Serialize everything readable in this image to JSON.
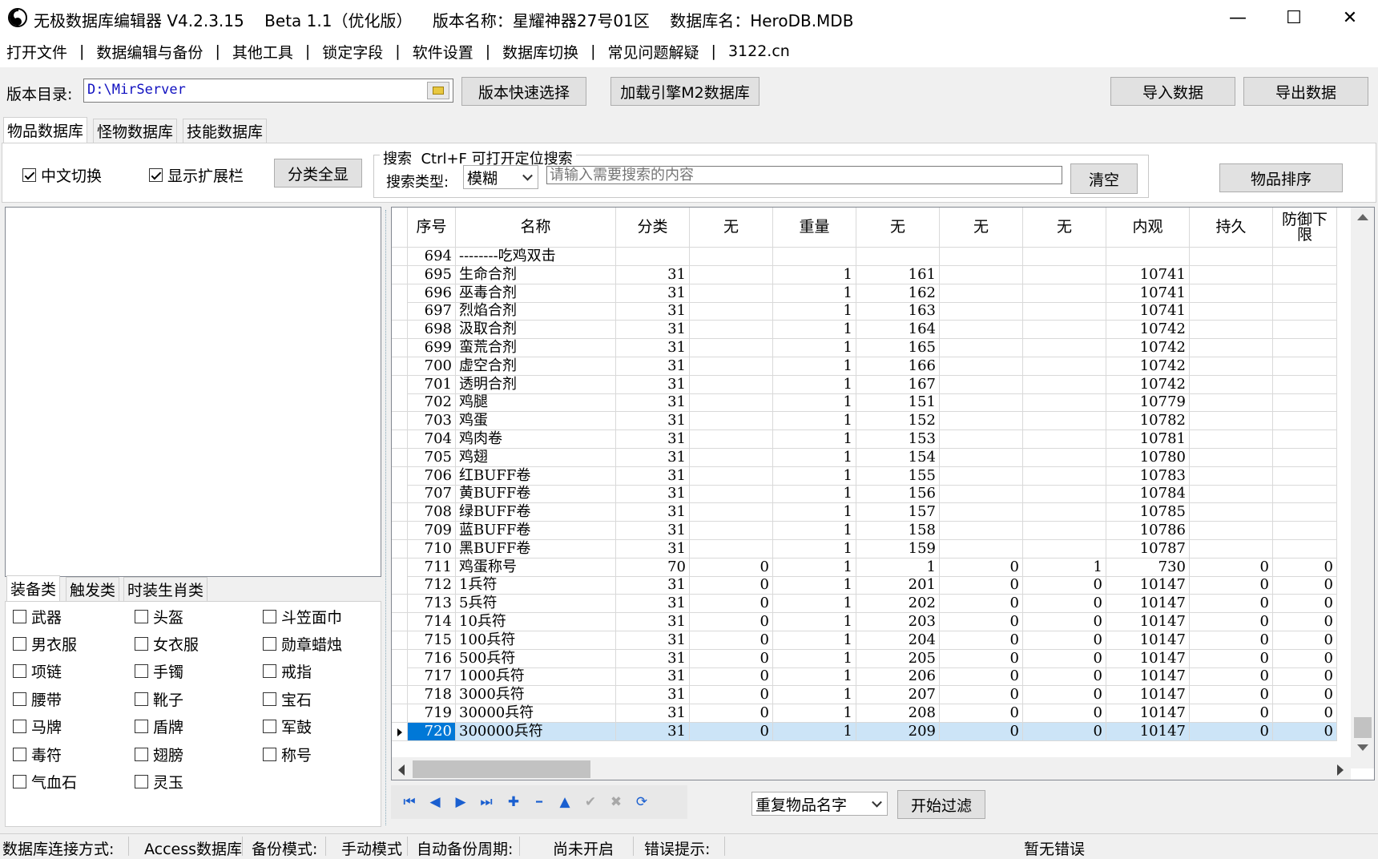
{
  "window": {
    "title": "无极数据库编辑器 V4.2.3.15    Beta 1.1（优化版）    版本名称：星耀神器27号01区    数据库名：HeroDB.MDB",
    "minimize": "—",
    "maximize": "☐",
    "close": "✕"
  },
  "menu": [
    "打开文件",
    "数据编辑与备份",
    "其他工具",
    "锁定字段",
    "软件设置",
    "数据库切换",
    "常见问题解疑",
    "3122.cn"
  ],
  "menu_sep": "|",
  "toolbar": {
    "dir_label": "版本目录:",
    "dir_value": "D:\\MirServer",
    "quick_select": "版本快速选择",
    "load_m2": "加载引擎M2数据库",
    "import": "导入数据",
    "export": "导出数据"
  },
  "tabs": [
    "物品数据库",
    "怪物数据库",
    "技能数据库"
  ],
  "filters": {
    "chinese_switch": "中文切换",
    "show_ext": "显示扩展栏",
    "show_all_cat": "分类全显",
    "search_legend": "搜索  Ctrl+F 可打开定位搜索",
    "search_type_label": "搜索类型:",
    "search_type_value": "模糊",
    "search_placeholder": "请输入需要搜索的内容",
    "clear": "清空",
    "sort": "物品排序"
  },
  "subtabs": [
    "装备类",
    "触发类",
    "时装生肖类"
  ],
  "categories": [
    [
      "武器",
      "头盔",
      "斗笠面巾"
    ],
    [
      "男衣服",
      "女衣服",
      "勋章蜡烛"
    ],
    [
      "项链",
      "手镯",
      "戒指"
    ],
    [
      "腰带",
      "靴子",
      "宝石"
    ],
    [
      "马牌",
      "盾牌",
      "军鼓"
    ],
    [
      "毒符",
      "翅膀",
      "称号"
    ],
    [
      "气血石",
      "灵玉"
    ]
  ],
  "grid": {
    "columns": [
      "序号",
      "名称",
      "分类",
      "无",
      "重量",
      "无",
      "无",
      "无",
      "内观",
      "持久",
      "防御下限"
    ],
    "rows": [
      [
        "694",
        "--------吃鸡双击",
        "",
        "",
        "",
        "",
        "",
        "",
        "",
        "",
        ""
      ],
      [
        "695",
        "生命合剂",
        "31",
        "",
        "1",
        "161",
        "",
        "",
        "10741",
        "",
        ""
      ],
      [
        "696",
        "巫毒合剂",
        "31",
        "",
        "1",
        "162",
        "",
        "",
        "10741",
        "",
        ""
      ],
      [
        "697",
        "烈焰合剂",
        "31",
        "",
        "1",
        "163",
        "",
        "",
        "10741",
        "",
        ""
      ],
      [
        "698",
        "汲取合剂",
        "31",
        "",
        "1",
        "164",
        "",
        "",
        "10742",
        "",
        ""
      ],
      [
        "699",
        "蛮荒合剂",
        "31",
        "",
        "1",
        "165",
        "",
        "",
        "10742",
        "",
        ""
      ],
      [
        "700",
        "虚空合剂",
        "31",
        "",
        "1",
        "166",
        "",
        "",
        "10742",
        "",
        ""
      ],
      [
        "701",
        "透明合剂",
        "31",
        "",
        "1",
        "167",
        "",
        "",
        "10742",
        "",
        ""
      ],
      [
        "702",
        "鸡腿",
        "31",
        "",
        "1",
        "151",
        "",
        "",
        "10779",
        "",
        ""
      ],
      [
        "703",
        "鸡蛋",
        "31",
        "",
        "1",
        "152",
        "",
        "",
        "10782",
        "",
        ""
      ],
      [
        "704",
        "鸡肉卷",
        "31",
        "",
        "1",
        "153",
        "",
        "",
        "10781",
        "",
        ""
      ],
      [
        "705",
        "鸡翅",
        "31",
        "",
        "1",
        "154",
        "",
        "",
        "10780",
        "",
        ""
      ],
      [
        "706",
        "红BUFF卷",
        "31",
        "",
        "1",
        "155",
        "",
        "",
        "10783",
        "",
        ""
      ],
      [
        "707",
        "黄BUFF卷",
        "31",
        "",
        "1",
        "156",
        "",
        "",
        "10784",
        "",
        ""
      ],
      [
        "708",
        "绿BUFF卷",
        "31",
        "",
        "1",
        "157",
        "",
        "",
        "10785",
        "",
        ""
      ],
      [
        "709",
        "蓝BUFF卷",
        "31",
        "",
        "1",
        "158",
        "",
        "",
        "10786",
        "",
        ""
      ],
      [
        "710",
        "黑BUFF卷",
        "31",
        "",
        "1",
        "159",
        "",
        "",
        "10787",
        "",
        ""
      ],
      [
        "711",
        "鸡蛋称号",
        "70",
        "0",
        "1",
        "1",
        "0",
        "1",
        "730",
        "0",
        "0"
      ],
      [
        "712",
        "1兵符",
        "31",
        "0",
        "1",
        "201",
        "0",
        "0",
        "10147",
        "0",
        "0"
      ],
      [
        "713",
        "5兵符",
        "31",
        "0",
        "1",
        "202",
        "0",
        "0",
        "10147",
        "0",
        "0"
      ],
      [
        "714",
        "10兵符",
        "31",
        "0",
        "1",
        "203",
        "0",
        "0",
        "10147",
        "0",
        "0"
      ],
      [
        "715",
        "100兵符",
        "31",
        "0",
        "1",
        "204",
        "0",
        "0",
        "10147",
        "0",
        "0"
      ],
      [
        "716",
        "500兵符",
        "31",
        "0",
        "1",
        "205",
        "0",
        "0",
        "10147",
        "0",
        "0"
      ],
      [
        "717",
        "1000兵符",
        "31",
        "0",
        "1",
        "206",
        "0",
        "0",
        "10147",
        "0",
        "0"
      ],
      [
        "718",
        "3000兵符",
        "31",
        "0",
        "1",
        "207",
        "0",
        "0",
        "10147",
        "0",
        "0"
      ],
      [
        "719",
        "30000兵符",
        "31",
        "0",
        "1",
        "208",
        "0",
        "0",
        "10147",
        "0",
        "0"
      ],
      [
        "720",
        "300000兵符",
        "31",
        "0",
        "1",
        "209",
        "0",
        "0",
        "10147",
        "0",
        "0"
      ]
    ],
    "selected_row": 26
  },
  "nav_icons": [
    "first-icon",
    "prior-icon",
    "next-icon",
    "last-icon",
    "insert-icon",
    "delete-icon",
    "edit-icon",
    "post-icon",
    "cancel-icon",
    "refresh-icon"
  ],
  "filter_bar": {
    "dup_name": "重复物品名字",
    "start_filter": "开始过滤"
  },
  "status": {
    "conn_label": "数据库连接方式:",
    "conn_value": "Access数据库",
    "backup_label": "备份模式:",
    "backup_value": "手动模式",
    "auto_label": "自动备份周期:",
    "auto_value": "尚未开启",
    "err_label": "错误提示:",
    "err_value": "暂无错误"
  },
  "colors": {
    "selection": "#cce4f7",
    "nav_blue": "#1a5fd0"
  }
}
